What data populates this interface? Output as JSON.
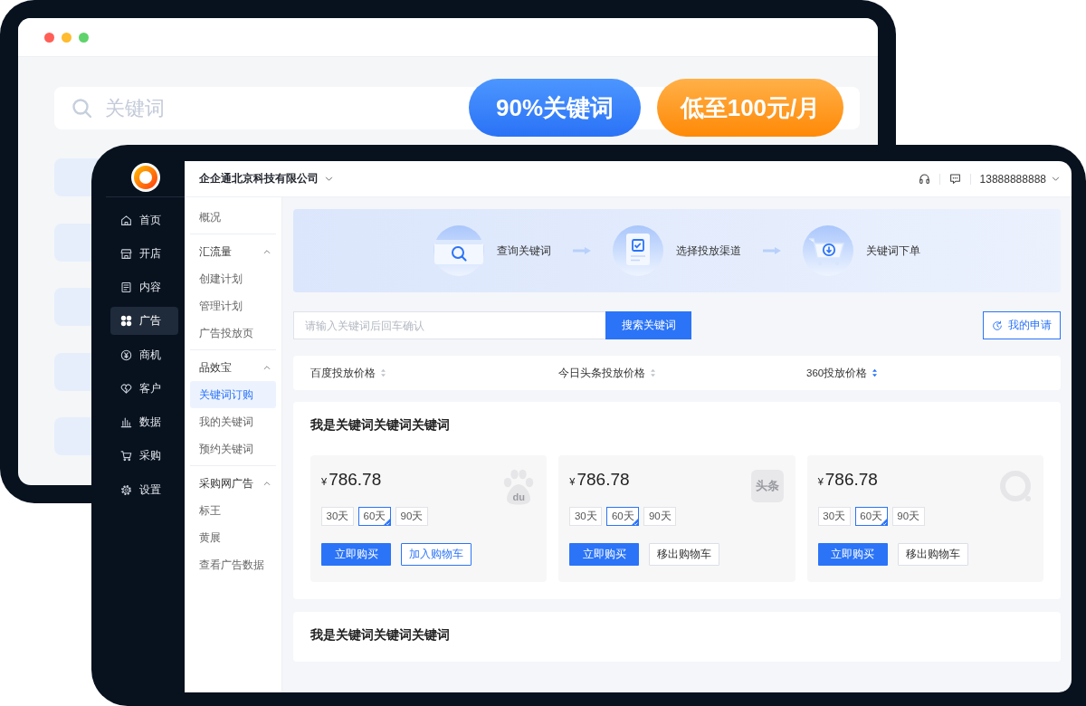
{
  "back_window": {
    "search": {
      "placeholder": "关键词"
    },
    "badges": [
      {
        "text": "90%关键词",
        "kind": "primary"
      },
      {
        "text": "低至100元/月",
        "kind": "accent"
      }
    ]
  },
  "app_window": {
    "sidebar": {
      "items": [
        {
          "label": "首页",
          "selected": false
        },
        {
          "label": "开店",
          "selected": false
        },
        {
          "label": "内容",
          "selected": false
        },
        {
          "label": "广告",
          "selected": true
        },
        {
          "label": "商机",
          "selected": false
        },
        {
          "label": "客户",
          "selected": false
        },
        {
          "label": "数据",
          "selected": false
        },
        {
          "label": "采购",
          "selected": false
        },
        {
          "label": "设置",
          "selected": false
        }
      ]
    },
    "header": {
      "company": "企企通北京科技有限公司",
      "account": "13888888888"
    },
    "subnav": {
      "items": [
        {
          "label": "概况",
          "selected": false
        },
        {
          "label": "汇流量",
          "expanded": true,
          "children": [
            {
              "label": "创建计划",
              "selected": false
            },
            {
              "label": "管理计划",
              "selected": false
            },
            {
              "label": "广告投放页",
              "selected": false
            }
          ]
        },
        {
          "label": "品效宝",
          "expanded": true,
          "children": [
            {
              "label": "关键词订购",
              "selected": true
            },
            {
              "label": "我的关键词",
              "selected": false
            },
            {
              "label": "预约关键词",
              "selected": false
            }
          ]
        },
        {
          "label": "采购网广告",
          "expanded": true,
          "children": [
            {
              "label": "标王",
              "selected": false
            },
            {
              "label": "黄展",
              "selected": false
            },
            {
              "label": "查看广告数据",
              "selected": false
            }
          ]
        }
      ]
    },
    "steps": [
      {
        "label": "查询关键词"
      },
      {
        "label": "选择投放渠道"
      },
      {
        "label": "关键词下单"
      }
    ],
    "search": {
      "placeholder": "请输入关键词后回车确认",
      "button": "搜索关键词"
    },
    "application_button": "我的申请",
    "sort_columns": [
      {
        "label": "百度投放价格",
        "selected": false
      },
      {
        "label": "今日头条投放价格",
        "selected": false
      },
      {
        "label": "360投放价格",
        "selected": true
      }
    ],
    "sections": [
      {
        "title": "我是关键词关键词关键词",
        "products": [
          {
            "currency": "¥",
            "price": "786.78",
            "logo_text": "du",
            "durations": [
              {
                "label": "30天",
                "selected": false
              },
              {
                "label": "60天",
                "selected": true
              },
              {
                "label": "90天",
                "selected": false
              }
            ],
            "buy_button": "立即购买",
            "cart_button": {
              "label": "加入购物车",
              "in_cart": false
            }
          },
          {
            "currency": "¥",
            "price": "786.78",
            "logo_text": "头条",
            "durations": [
              {
                "label": "30天",
                "selected": false
              },
              {
                "label": "60天",
                "selected": true
              },
              {
                "label": "90天",
                "selected": false
              }
            ],
            "buy_button": "立即购买",
            "cart_button": {
              "label": "移出购物车",
              "in_cart": true
            }
          },
          {
            "currency": "¥",
            "price": "786.78",
            "durations": [
              {
                "label": "30天",
                "selected": false
              },
              {
                "label": "60天",
                "selected": true
              },
              {
                "label": "90天",
                "selected": false
              }
            ],
            "buy_button": "立即购买",
            "cart_button": {
              "label": "移出购物车",
              "in_cart": true
            }
          }
        ]
      },
      {
        "title": "我是关键词关键词关键词"
      }
    ]
  }
}
